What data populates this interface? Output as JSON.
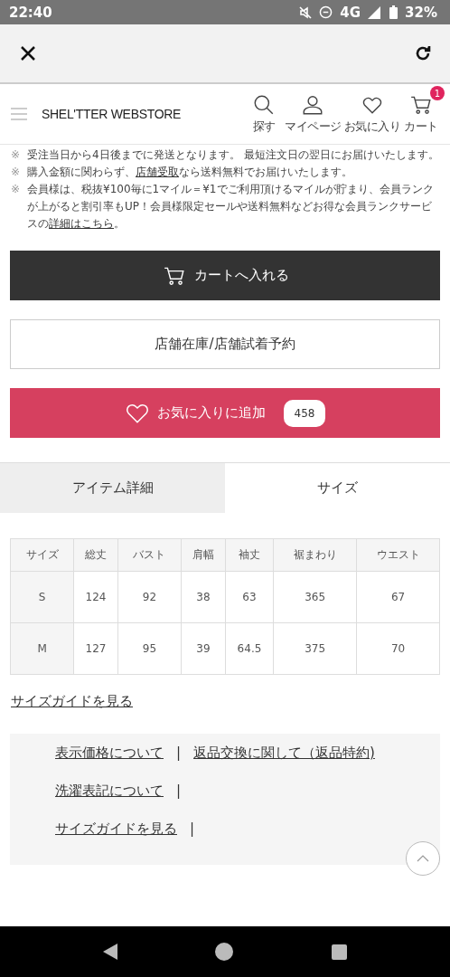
{
  "status_bar": {
    "time": "22:40",
    "network": "4G",
    "battery": "32%"
  },
  "header": {
    "brand": "SHEL'TTER WEBSTORE",
    "nav": [
      {
        "kind": "search",
        "label": "探す"
      },
      {
        "kind": "user",
        "label": "マイページ"
      },
      {
        "kind": "heart",
        "label": "お気に入り"
      },
      {
        "kind": "cart",
        "label": "カート",
        "badge": "1"
      }
    ]
  },
  "notes": [
    {
      "mark": "※",
      "parts": [
        {
          "kind": "text",
          "text": "受注当日から4日後までに発送となります。 最短注文日の翌日にお届けいたします。"
        }
      ]
    },
    {
      "mark": "※",
      "parts": [
        {
          "kind": "text",
          "text": "購入金額に関わらず、"
        },
        {
          "kind": "link",
          "text": "店舗受取"
        },
        {
          "kind": "text",
          "text": "なら送料無料でお届けいたします。"
        }
      ]
    },
    {
      "mark": "※",
      "parts": [
        {
          "kind": "text",
          "text": "会員様は、税抜¥100毎に1マイル＝¥1でご利用頂けるマイルが貯まり、会員ランクが上がると割引率もUP！会員様限定セールや送料無料などお得な会員ランクサービスの"
        },
        {
          "kind": "link",
          "text": "詳細はこちら"
        },
        {
          "kind": "text",
          "text": "。"
        }
      ]
    }
  ],
  "buttons": [
    {
      "kind": "cart",
      "label": "カートへ入れる"
    },
    {
      "kind": "store",
      "label": "店舗在庫/店舗試着予約"
    },
    {
      "kind": "favorite",
      "label": "お気に入りに追加",
      "count": "458"
    }
  ],
  "tabs": [
    {
      "label": "アイテム詳細",
      "selected": false
    },
    {
      "label": "サイズ",
      "selected": true
    }
  ],
  "table": {
    "columns": [
      "サイズ",
      "総丈",
      "バスト",
      "肩幅",
      "袖丈",
      "裾まわり",
      "ウエスト"
    ],
    "rows": [
      [
        "S",
        "124",
        "92",
        "38",
        "63",
        "365",
        "67"
      ],
      [
        "M",
        "127",
        "95",
        "39",
        "64.5",
        "375",
        "70"
      ]
    ]
  },
  "size_guide_link": "サイズガイドを見る",
  "footer": {
    "rows": [
      [
        {
          "text": "表示価格について",
          "separator": "|"
        },
        {
          "text": "返品交換に関して（返品特約)"
        }
      ],
      [
        {
          "text": "洗濯表記について",
          "separator": "|"
        }
      ],
      [
        {
          "text": "サイズガイドを見る",
          "separator": "|"
        }
      ]
    ]
  }
}
